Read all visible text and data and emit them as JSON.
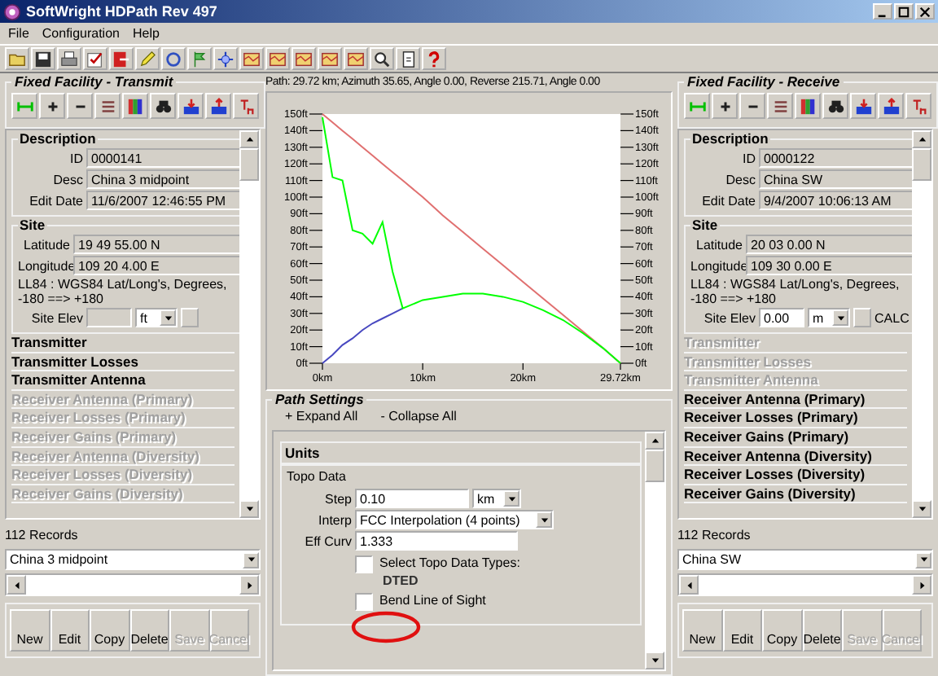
{
  "window": {
    "title": "SoftWright HDPath Rev 497"
  },
  "menu": [
    "File",
    "Configuration",
    "Help"
  ],
  "path_info": "Path: 29.72 km; Azimuth 35.65, Angle 0.00, Reverse 215.71, Angle 0.00",
  "facilities": [
    {
      "title": "Fixed Facility - Transmit",
      "description": {
        "title": "Description",
        "fields": [
          {
            "label": "ID",
            "value": "0000141"
          },
          {
            "label": "Desc",
            "value": "China 3 midpoint"
          },
          {
            "label": "Edit Date",
            "value": "11/6/2007 12:46:55 PM"
          }
        ]
      },
      "site": {
        "title": "Site",
        "latitude_label": "Latitude",
        "latitude": "19 49 55.00 N",
        "longitude_label": "Longitude",
        "longitude": "109 20 4.00 E",
        "datum": "LL84 : WGS84 Lat/Long's, Degrees, -180 ==> +180",
        "elev_label": "Site Elev",
        "elev_enabled": false,
        "elev_unit": "ft"
      },
      "sections": [
        {
          "label": "Transmitter",
          "disabled": false
        },
        {
          "label": "Transmitter Losses",
          "disabled": false
        },
        {
          "label": "Transmitter Antenna",
          "disabled": false
        },
        {
          "label": "Receiver Antenna (Primary)",
          "disabled": true
        },
        {
          "label": "Receiver Losses (Primary)",
          "disabled": true
        },
        {
          "label": "Receiver Gains (Primary)",
          "disabled": true
        },
        {
          "label": "Receiver Antenna (Diversity)",
          "disabled": true
        },
        {
          "label": "Receiver Losses (Diversity)",
          "disabled": true
        },
        {
          "label": "Receiver Gains (Diversity)",
          "disabled": true
        }
      ],
      "records": "112 Records",
      "selector": "China 3 midpoint",
      "buttons": [
        {
          "label": "New",
          "disabled": false
        },
        {
          "label": "Edit",
          "disabled": false
        },
        {
          "label": "Copy",
          "disabled": false
        },
        {
          "label": "Delete",
          "disabled": false
        },
        {
          "label": "Save",
          "disabled": true
        },
        {
          "label": "Cancel",
          "disabled": true
        }
      ]
    },
    {
      "title": "Fixed Facility - Receive",
      "description": {
        "title": "Description",
        "fields": [
          {
            "label": "ID",
            "value": "0000122"
          },
          {
            "label": "Desc",
            "value": "China SW"
          },
          {
            "label": "Edit Date",
            "value": "9/4/2007 10:06:13 AM"
          }
        ]
      },
      "site": {
        "title": "Site",
        "latitude_label": "Latitude",
        "latitude": "20 03 0.00 N",
        "longitude_label": "Longitude",
        "longitude": "109 30 0.00 E",
        "datum": "LL84 : WGS84 Lat/Long's, Degrees, -180 ==> +180",
        "elev_label": "Site Elev",
        "elev": "0.00",
        "elev_enabled": true,
        "elev_unit": "m",
        "calc": "CALC"
      },
      "sections": [
        {
          "label": "Transmitter",
          "disabled": true
        },
        {
          "label": "Transmitter Losses",
          "disabled": true
        },
        {
          "label": "Transmitter Antenna",
          "disabled": true
        },
        {
          "label": "Receiver Antenna (Primary)",
          "disabled": false
        },
        {
          "label": "Receiver Losses (Primary)",
          "disabled": false
        },
        {
          "label": "Receiver Gains (Primary)",
          "disabled": false
        },
        {
          "label": "Receiver Antenna (Diversity)",
          "disabled": false
        },
        {
          "label": "Receiver Losses (Diversity)",
          "disabled": false
        },
        {
          "label": "Receiver Gains (Diversity)",
          "disabled": false
        }
      ],
      "records": "112 Records",
      "selector": "China SW",
      "buttons": [
        {
          "label": "New",
          "disabled": false
        },
        {
          "label": "Edit",
          "disabled": false
        },
        {
          "label": "Copy",
          "disabled": false
        },
        {
          "label": "Delete",
          "disabled": false
        },
        {
          "label": "Save",
          "disabled": true
        },
        {
          "label": "Cancel",
          "disabled": true
        }
      ]
    }
  ],
  "profile": {
    "chart_data": {
      "type": "line",
      "x": [
        0,
        1,
        2,
        3,
        4,
        5,
        6,
        7,
        8,
        10,
        12,
        14,
        16,
        18,
        20,
        22,
        24,
        26,
        28,
        29.72
      ],
      "series": [
        {
          "color": "#4848c0",
          "values": [
            0,
            5,
            11,
            15,
            20,
            24,
            27,
            30,
            33,
            null,
            null,
            null,
            null,
            null,
            null,
            null,
            null,
            null,
            null,
            null
          ]
        },
        {
          "color": "#e07070",
          "values": [
            150,
            145,
            140,
            135,
            130,
            125,
            120,
            115,
            110,
            100,
            89,
            79,
            69,
            59,
            49,
            39,
            29,
            19,
            9,
            0
          ]
        },
        {
          "color": "#00ff00",
          "values": [
            148,
            112,
            110,
            80,
            78,
            72,
            85,
            55,
            33,
            38,
            40,
            42,
            42,
            40,
            37,
            32,
            26,
            18,
            9,
            0
          ]
        }
      ],
      "xlim": [
        0,
        29.72
      ],
      "ylim": [
        0,
        150
      ],
      "xticks": [
        {
          "value": 0,
          "label": "0km"
        },
        {
          "value": 10,
          "label": "10km"
        },
        {
          "value": 20,
          "label": "20km"
        },
        {
          "value": 29.72,
          "label": "29.72km"
        }
      ],
      "yticks": [
        {
          "value": 0,
          "label": "0ft"
        },
        {
          "value": 10,
          "label": "10ft"
        },
        {
          "value": 20,
          "label": "20ft"
        },
        {
          "value": 30,
          "label": "30ft"
        },
        {
          "value": 40,
          "label": "40ft"
        },
        {
          "value": 50,
          "label": "50ft"
        },
        {
          "value": 60,
          "label": "60ft"
        },
        {
          "value": 70,
          "label": "70ft"
        },
        {
          "value": 80,
          "label": "80ft"
        },
        {
          "value": 90,
          "label": "90ft"
        },
        {
          "value": 100,
          "label": "100ft"
        },
        {
          "value": 110,
          "label": "110ft"
        },
        {
          "value": 120,
          "label": "120ft"
        },
        {
          "value": 130,
          "label": "130ft"
        },
        {
          "value": 140,
          "label": "140ft"
        },
        {
          "value": 150,
          "label": "150ft"
        }
      ]
    }
  },
  "path_settings": {
    "title": "Path Settings",
    "links": [
      "+ Expand All",
      "- Collapse All"
    ],
    "units": "Units",
    "topo_data": {
      "title": "Topo Data",
      "step_label": "Step",
      "step": "0.10",
      "step_unit": "km",
      "interp_label": "Interp",
      "interp": "FCC Interpolation (4 points)",
      "eff_curv_label": "Eff Curv",
      "eff_curv": "1.333",
      "checkboxes": [
        {
          "label": "Select Topo Data Types:",
          "checked": false,
          "note": "DTED"
        },
        {
          "label": "Bend Line of Sight",
          "checked": false
        }
      ]
    }
  }
}
